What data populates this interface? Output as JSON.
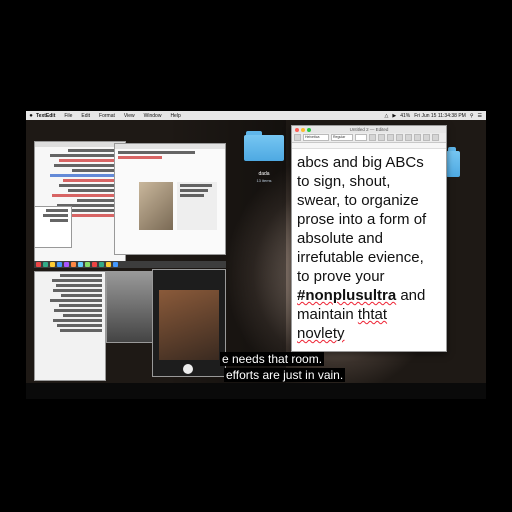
{
  "menubar": {
    "app_name": "TextEdit",
    "items": [
      "File",
      "Edit",
      "Format",
      "View",
      "Window",
      "Help"
    ],
    "clock": "Fri Jun 15  11:34:38 PM",
    "battery": "41%"
  },
  "desktop": {
    "folder_name": "dada",
    "folder_count": "13 items"
  },
  "textedit": {
    "window_title": "Untitled 2 — Edited",
    "font_family": "Helvetica",
    "font_style": "Regular",
    "lines": [
      "abcs and big ABCs",
      "to sign, shout,",
      "swear, to organize",
      "prose into a form of",
      "absolute and",
      "irrefutable evience,",
      "to prove your"
    ],
    "hashtag": "#nonplusultra",
    "hashtag_tail": " and",
    "line_maintain": "maintain ",
    "word_thtat": "thtat",
    "word_novlety": "novlety"
  },
  "subtitles": {
    "line1": "e needs that room.",
    "line2": "efforts are just in vain."
  },
  "colors": {
    "folder_blue": "#5fb6ea",
    "traffic_red": "#fc5f57",
    "traffic_yellow": "#fdbc2e",
    "traffic_green": "#28c840",
    "spellcheck_red": "#e23333"
  }
}
